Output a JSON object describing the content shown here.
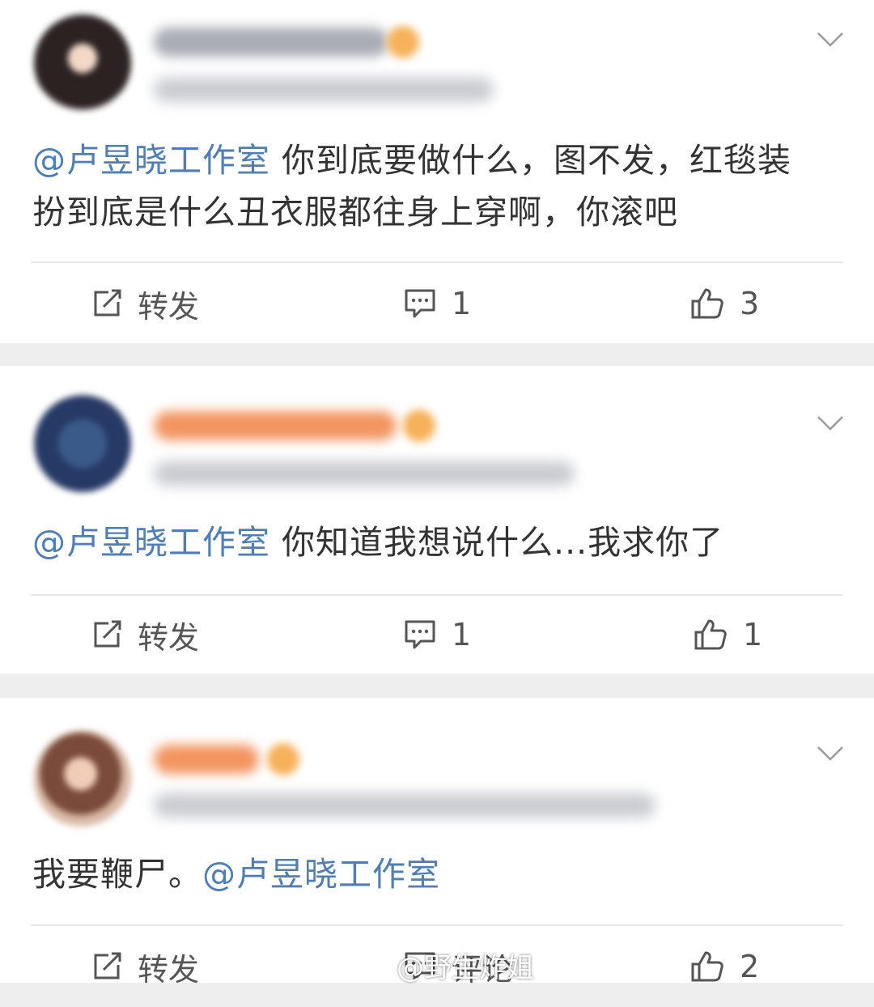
{
  "comments": [
    {
      "mention": "@卢昱晓工作室",
      "text_line1": " 你到底要做什么，图不发，红毯装",
      "text_line2": "扮到底是什么丑衣服都往身上穿啊，你滚吧",
      "repost_label": "转发",
      "comment_count": "1",
      "like_count": "3"
    },
    {
      "mention": "@卢昱晓工作室",
      "text_line1": " 你知道我想说什么...我求你了",
      "repost_label": "转发",
      "comment_count": "1",
      "like_count": "1"
    },
    {
      "text_before": "我要鞭尸。",
      "mention": "@卢昱晓工作室",
      "repost_label": "转发",
      "comment_count": "评论",
      "like_count": "2"
    }
  ],
  "watermark": "@野生炸姐",
  "colors": {
    "mention": "#4f7db8",
    "separator": "#eeeeee",
    "icon": "#555555"
  },
  "icons": [
    "chevron-down-icon",
    "repost-icon",
    "comment-icon",
    "like-icon",
    "weibo-logo-icon"
  ]
}
